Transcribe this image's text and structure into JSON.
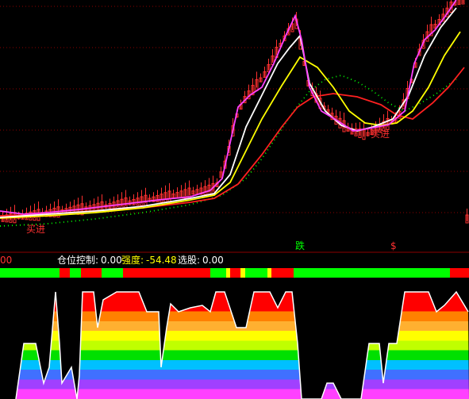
{
  "indicator_bar": {
    "prefix": "00",
    "position_label": "仓位控制:",
    "position_value": "0.00",
    "strength_label": "强度:",
    "strength_value": "-54.48",
    "select_label": "选股:",
    "select_value": "0.00"
  },
  "signals": {
    "buy": "买进",
    "buy_mid": "买进",
    "sell": "卖出",
    "fall": "跌",
    "dollar": "$"
  },
  "colors": {
    "background": "#000000",
    "grid": "#8b0000",
    "up_candle": "#ff3030",
    "down_candle": "#00ffff",
    "ma_white": "#ffffff",
    "ma_yellow": "#ffff00",
    "ma_magenta": "#ff40ff",
    "ma_red": "#ff2020",
    "dotted_green": "#00ff00",
    "bar_green": "#00ff00",
    "bar_red": "#ff0000"
  }
}
